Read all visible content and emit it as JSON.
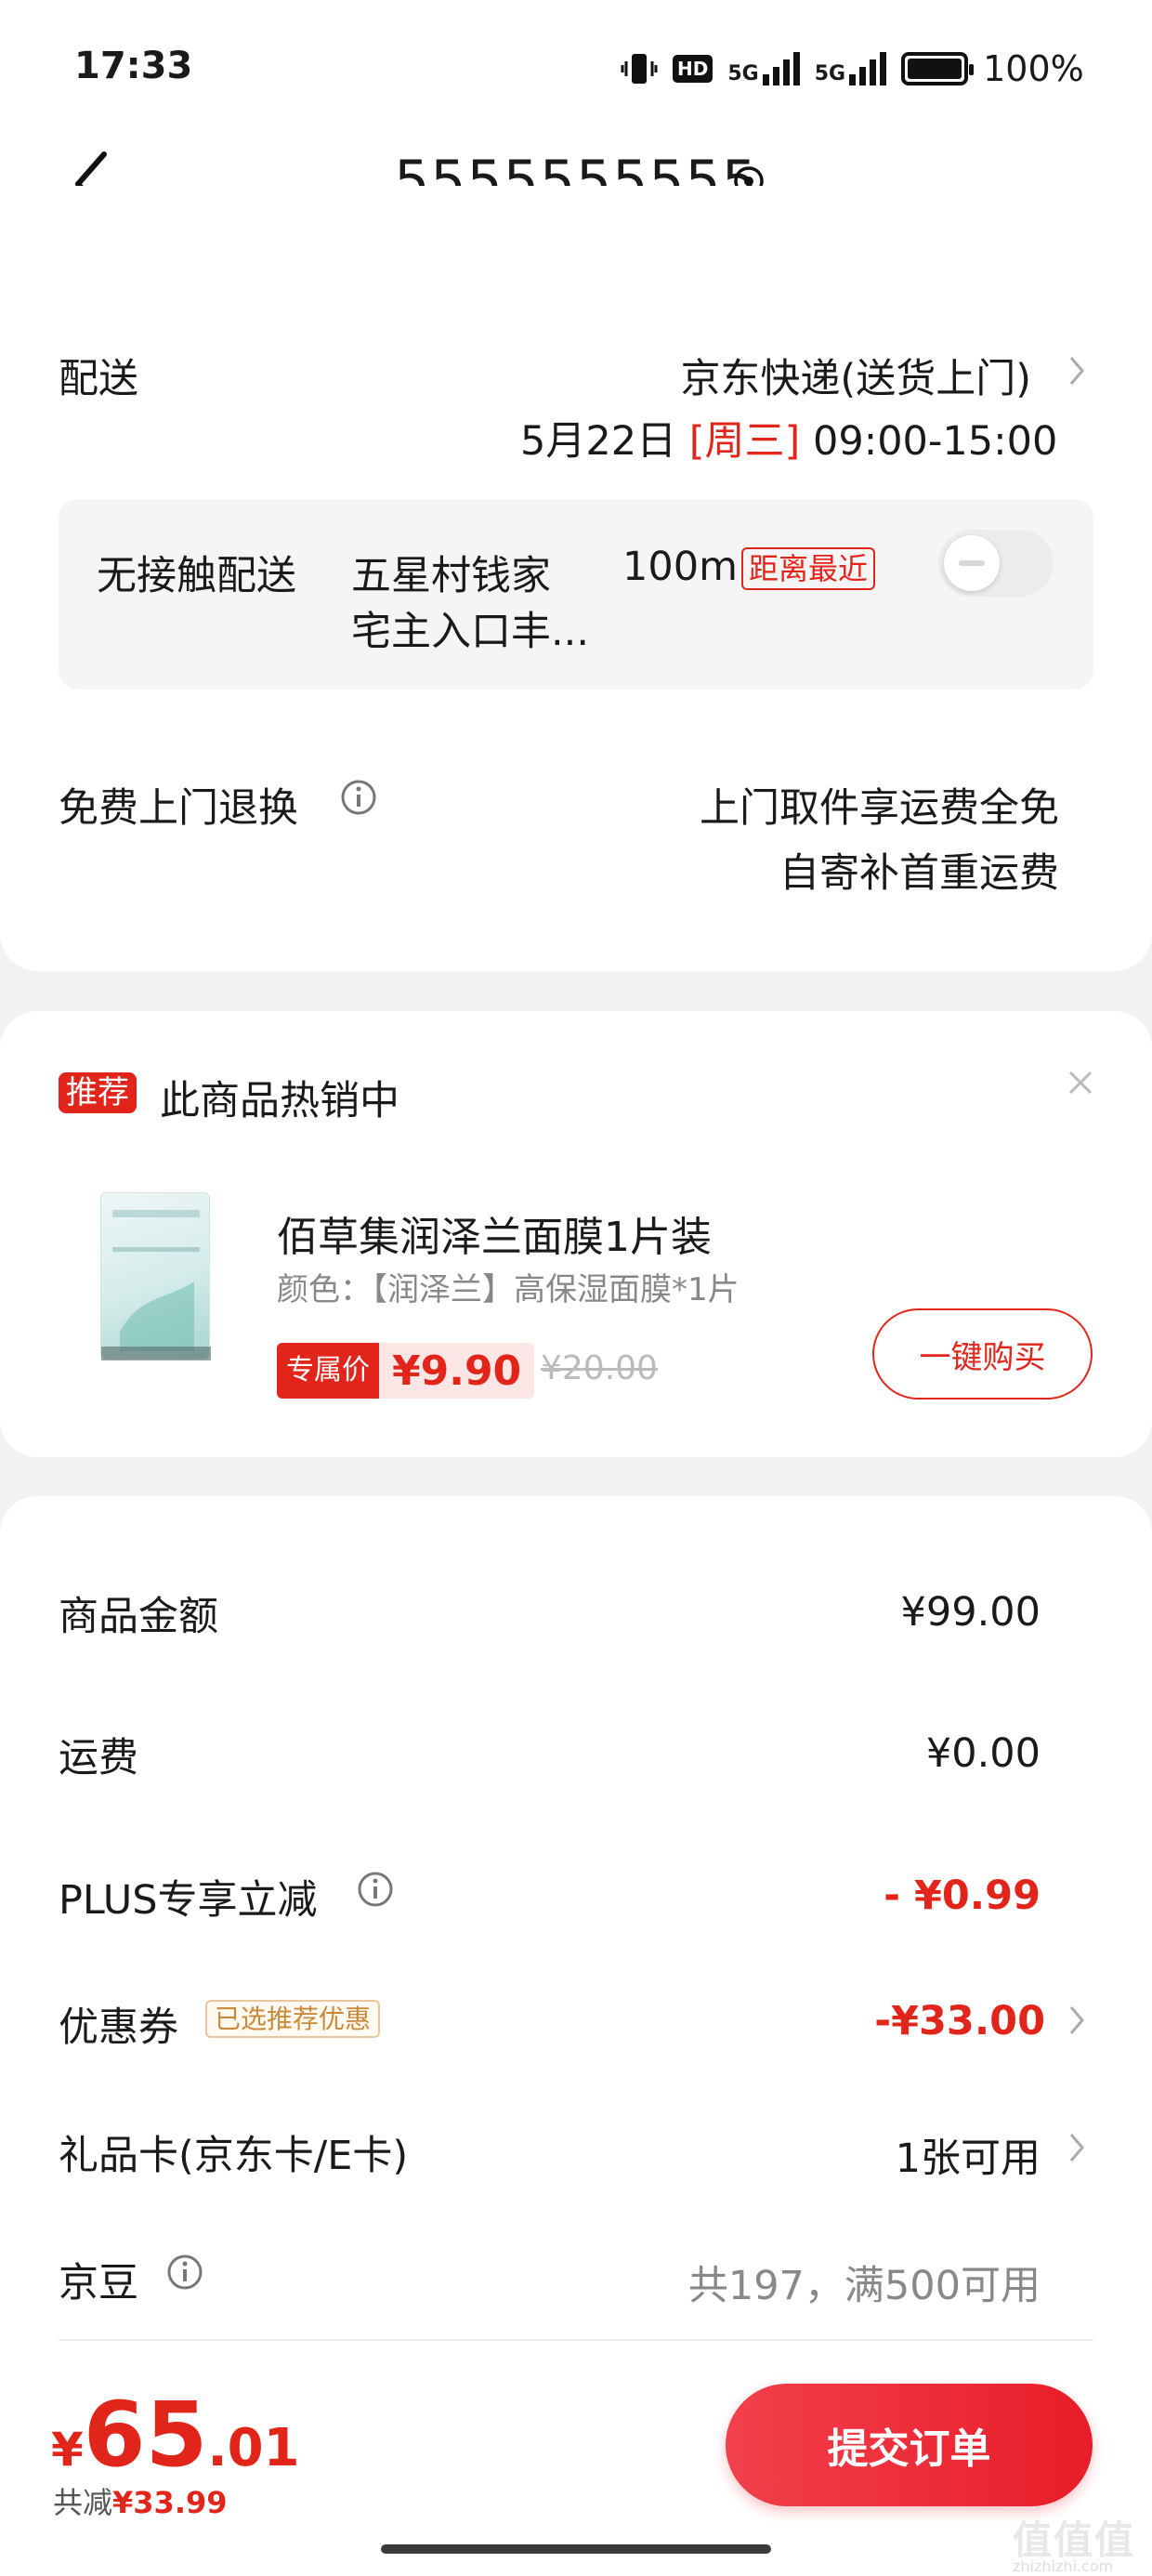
{
  "status_bar": {
    "time": "17:33",
    "hd": "HD",
    "sig1": "5G",
    "sig2": "5G",
    "battery": "100%"
  },
  "nav": {
    "title": "5555555555"
  },
  "delivery": {
    "label": "配送",
    "carrier": "京东快递(送货上门)",
    "date": "5月22日",
    "weekday": "[周三]",
    "timeslot": "09:00-15:00"
  },
  "no_contact": {
    "label": "无接触配送",
    "location_line1": "五星村钱家",
    "location_line2": "宅主入口丰...",
    "distance": "100m",
    "nearest_tag": "距离最近",
    "enabled": false
  },
  "return": {
    "label": "免费上门退换",
    "line1": "上门取件享运费全免",
    "line2": "自寄补首重运费"
  },
  "recommend": {
    "tag": "推荐",
    "title": "此商品热销中",
    "product_name": "佰草集润泽兰面膜1片装",
    "product_spec": "颜色：【润泽兰】高保湿面膜*1片",
    "price_label": "专属价",
    "price": "¥9.90",
    "original_price": "¥20.00",
    "buy_label": "一键购买"
  },
  "summary": {
    "goods_label": "商品金额",
    "goods_value": "¥99.00",
    "shipping_label": "运费",
    "shipping_value": "¥0.00",
    "plus_label": "PLUS专享立减",
    "plus_value": "- ¥0.99",
    "coupon_label": "优惠券",
    "coupon_tag": "已选推荐优惠",
    "coupon_value": "-¥33.00",
    "giftcard_label": "礼品卡(京东卡/E卡)",
    "giftcard_value": "1张可用",
    "jingdou_label": "京豆",
    "jingdou_value": "共197，满500可用"
  },
  "footer": {
    "currency": "¥",
    "total_int": "65",
    "total_dec": ".01",
    "saved_label": "共减",
    "saved_value": "¥33.99",
    "submit_label": "提交订单"
  },
  "watermark": {
    "glyphs": "值值值",
    "domain": "zhizhizhi.com"
  },
  "colors": {
    "accent": "#e1251b",
    "background": "#f2f2f2"
  },
  "icons": [
    "vibrate-icon",
    "hd-icon",
    "signal-icon",
    "battery-icon",
    "back-icon",
    "location-pin-icon",
    "chevron-right-icon",
    "info-icon",
    "close-icon"
  ]
}
